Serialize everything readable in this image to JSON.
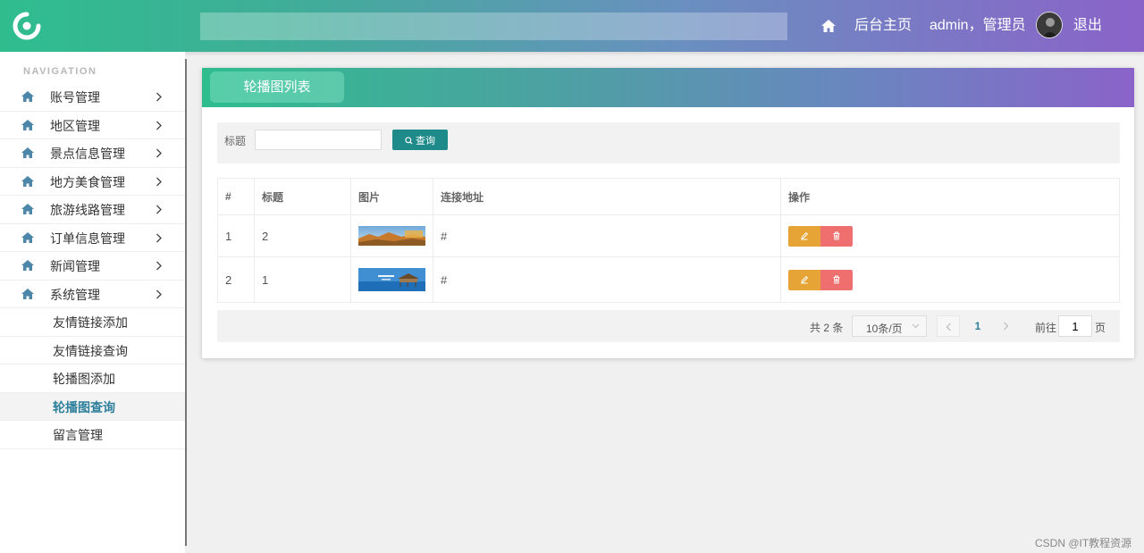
{
  "header": {
    "search_placeholder": "",
    "home_label": "后台主页",
    "user_label": "admin，管理员",
    "logout_label": "退出"
  },
  "sidebar": {
    "caption": "NAVIGATION",
    "items": [
      {
        "label": "账号管理",
        "icon": "home-icon"
      },
      {
        "label": "地区管理",
        "icon": "home-icon"
      },
      {
        "label": "景点信息管理",
        "icon": "home-icon"
      },
      {
        "label": "地方美食管理",
        "icon": "home-icon"
      },
      {
        "label": "旅游线路管理",
        "icon": "home-icon"
      },
      {
        "label": "订单信息管理",
        "icon": "home-icon"
      },
      {
        "label": "新闻管理",
        "icon": "home-icon"
      },
      {
        "label": "系统管理",
        "icon": "home-icon"
      }
    ],
    "sub_items": [
      {
        "label": "友情链接添加"
      },
      {
        "label": "友情链接查询"
      },
      {
        "label": "轮播图添加"
      },
      {
        "label": "轮播图查询",
        "active": true
      },
      {
        "label": "留言管理"
      }
    ]
  },
  "panel": {
    "title": "轮播图列表",
    "search": {
      "label": "标题",
      "value": "",
      "button_label": "查询"
    },
    "table": {
      "headers": [
        "#",
        "标题",
        "图片",
        "连接地址",
        "操作"
      ],
      "rows": [
        {
          "index": "1",
          "title": "2",
          "image": "banner-autumn-landscape",
          "link": "#"
        },
        {
          "index": "2",
          "title": "1",
          "image": "banner-sea-villa",
          "link": "#"
        }
      ]
    },
    "pagination": {
      "total": "共 2 条",
      "page_size": "10条/页",
      "current_page": "1",
      "goto_label": "前往",
      "goto_value": "1",
      "page_unit": "页"
    }
  },
  "watermark": "CSDN @IT教程资源",
  "colors": {
    "header_start": "#2fbd8e",
    "header_end": "#8a63c9",
    "primary_button": "#1f8a8a",
    "edit_button": "#e6a336",
    "delete_button": "#ef6e6e",
    "active_nav": "#2e7f9b"
  }
}
